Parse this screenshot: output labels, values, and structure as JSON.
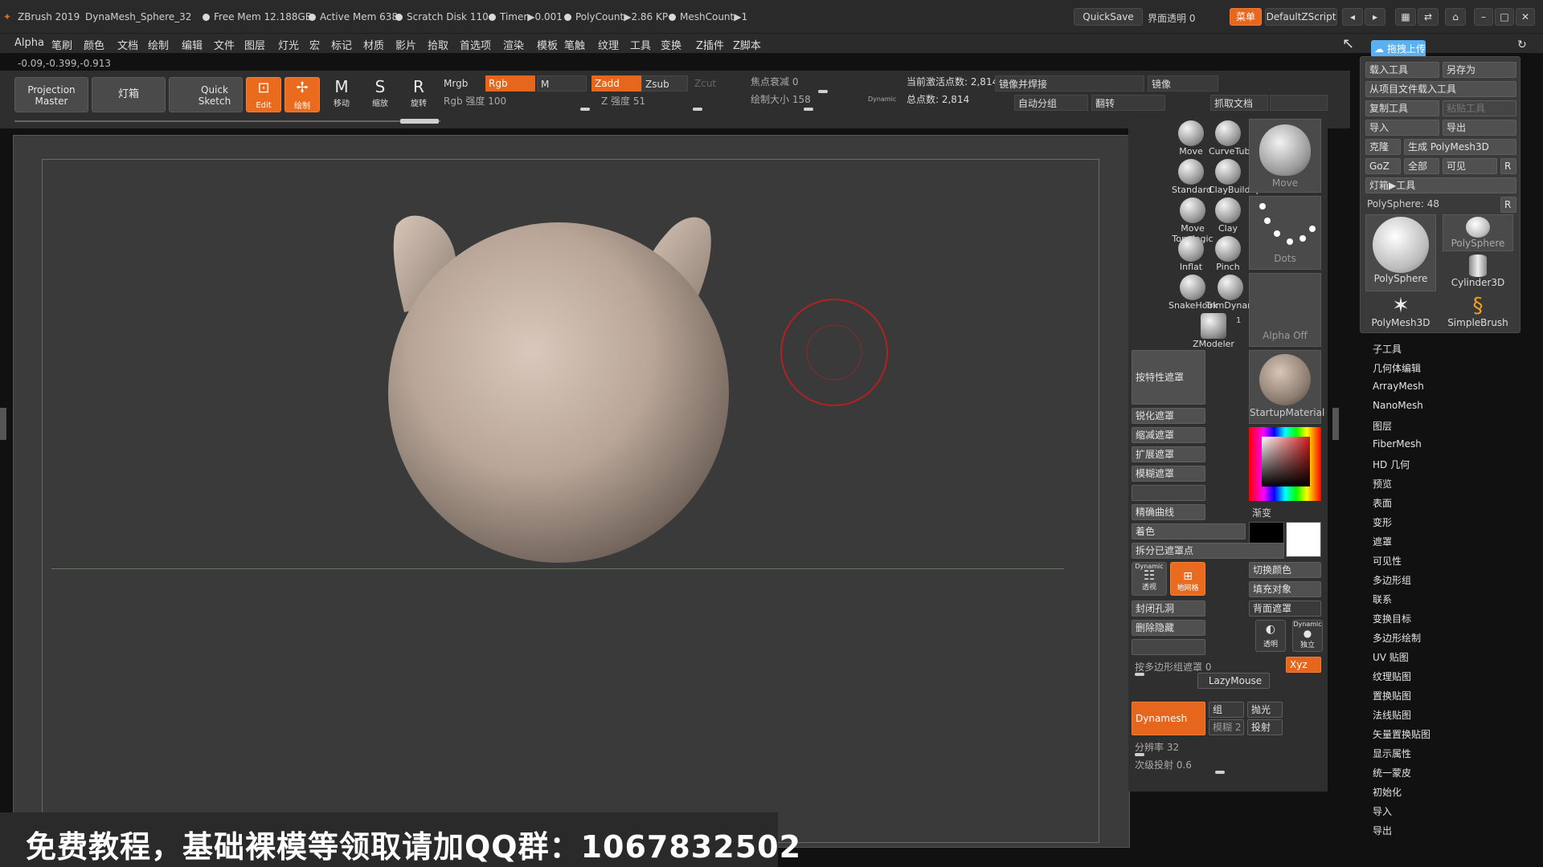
{
  "titlebar": {
    "app": "ZBrush 2019",
    "file": "DynaMesh_Sphere_32",
    "free_mem": "Free Mem 12.188GB",
    "active_mem": "Active Mem 638",
    "scratch_disk": "Scratch Disk 110",
    "timer": "Timer▶0.001",
    "polycount": "PolyCount▶2.86 KP",
    "meshcount": "MeshCount▶1",
    "quicksave": "QuickSave",
    "interface_transparency": "界面透明 0",
    "menu_btn": "菜单",
    "default_script": "DefaultZScript"
  },
  "menubar": [
    "Alpha",
    "笔刷",
    "颜色",
    "文档",
    "绘制",
    "编辑",
    "文件",
    "图层",
    "灯光",
    "宏",
    "标记",
    "材质",
    "影片",
    "拾取",
    "首选项",
    "渲染",
    "模板",
    "笔触",
    "纹理",
    "工具",
    "变换",
    "Z插件",
    "Z脚本"
  ],
  "coords": "-0.09,-0.399,-0.913",
  "shelf": {
    "projection_master": "Projection Master",
    "lightbox": "灯箱",
    "quick_sketch": "Quick Sketch",
    "edit": "Edit",
    "draw": "绘制",
    "move": "移动",
    "scale": "缩放",
    "rotate": "旋转",
    "mrgb": "Mrgb",
    "rgb": "Rgb",
    "m": "M",
    "rgb_intensity_label": "Rgb 强度",
    "rgb_intensity": "100",
    "zadd": "Zadd",
    "zsub": "Zsub",
    "zcut": "Zcut",
    "z_intensity_label": "Z 强度",
    "z_intensity": "51",
    "focal_shift_label": "焦点衰减",
    "focal_shift": "0",
    "draw_size_label": "绘制大小",
    "draw_size": "158",
    "dynamic": "Dynamic",
    "active_points": "当前激活点数: 2,814",
    "total_points": "总点数: 2,814",
    "mirror_weld": "镜像并焊接",
    "mirror": "镜像",
    "auto_groups": "自动分组",
    "flip": "翻转",
    "grab_doc": "抓取文档"
  },
  "brushes": [
    {
      "label": "Move",
      "sub": "CurveTube"
    },
    {
      "label": "Standard",
      "sub": "ClayBuildup"
    },
    {
      "label": "Move Topologic",
      "sub": "Clay"
    },
    {
      "label": "Inflat",
      "sub": "Pinch"
    },
    {
      "label": "SnakeHook",
      "sub": "TrimDynamic"
    }
  ],
  "zmodeler": "ZModeler",
  "zmodeler_count": "1",
  "thumbs": {
    "move": "Move",
    "dots": "Dots",
    "alpha_off": "Alpha Off",
    "material": "StartupMaterial",
    "gradient": "渐变"
  },
  "masking": {
    "by_feature": "按特性遮罩",
    "sharpen": "锐化遮罩",
    "shrink": "缩减遮罩",
    "grow": "扩展遮罩",
    "blur": "模糊遮罩",
    "precise_curve": "精确曲线",
    "colorize": "着色",
    "split_masked": "拆分已遮罩点",
    "switch_color": "切换颜色",
    "fill_object": "填充对象",
    "back_mask": "背面遮罩",
    "close_holes": "封闭孔洞",
    "del_hidden": "删除隐藏",
    "by_polygroup": "按多边形组遮罩",
    "by_polygroup_val": "0",
    "lazymouse": "LazyMouse",
    "persp": "透视",
    "floor": "地网格",
    "transp": "透明",
    "solo": "独立",
    "xyz": "Xyz",
    "dynamesh": "Dynamesh",
    "groups": "组",
    "polish": "抛光",
    "blur_label": "模糊",
    "blur_val": "2",
    "project": "投射",
    "resolution_label": "分辨率",
    "resolution": "32",
    "subproject_label": "次级投射",
    "subproject": "0.6"
  },
  "toolpanel": {
    "upload": "拖拽上传",
    "load_tool": "载入工具",
    "save_as": "另存为",
    "load_from_project": "从项目文件载入工具",
    "copy_tool": "复制工具",
    "paste_tool": "粘贴工具",
    "import": "导入",
    "export": "导出",
    "clone": "克隆",
    "make_polymesh": "生成 PolyMesh3D",
    "goz": "GoZ",
    "all": "全部",
    "visible": "可见",
    "r": "R",
    "lightbox_tools": "灯箱▶工具",
    "current": "PolySphere: 48",
    "tools": [
      "PolySphere",
      "PolySphere",
      "Cylinder3D",
      "PolyMesh3D",
      "SimpleBrush"
    ]
  },
  "submenu": [
    "子工具",
    "几何体编辑",
    "ArrayMesh",
    "NanoMesh",
    "图层",
    "FiberMesh",
    "HD 几何",
    "预览",
    "表面",
    "变形",
    "遮罩",
    "可见性",
    "多边形组",
    "联系",
    "变换目标",
    "多边形绘制",
    "UV 贴图",
    "纹理贴图",
    "置换贴图",
    "法线贴图",
    "矢量置换贴图",
    "显示属性",
    "统一蒙皮",
    "初始化",
    "导入",
    "导出"
  ],
  "banner": "免费教程，基础裸模等领取请加QQ群：1067832502",
  "colors": {
    "accent": "#e6661e",
    "bg": "#3a3a3a",
    "mesh": "#c8b6a8"
  }
}
